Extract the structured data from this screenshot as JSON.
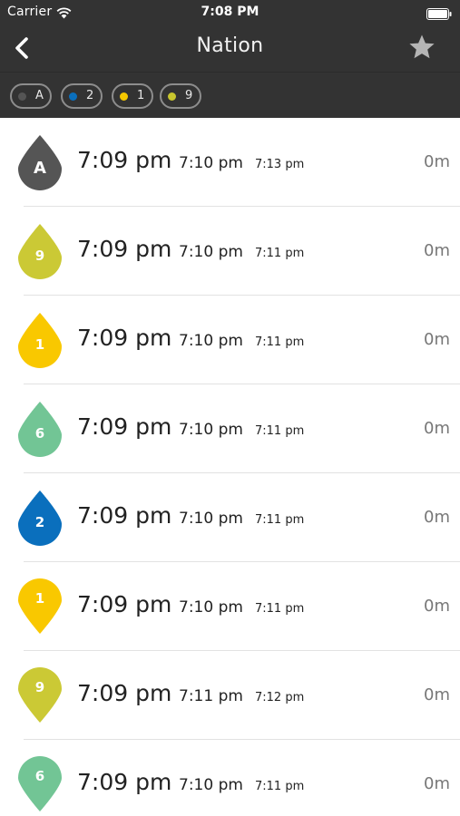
{
  "status_bar": {
    "carrier": "Carrier",
    "time": "7:08 PM"
  },
  "nav": {
    "title": "Nation",
    "back_icon": "chevron-left-icon",
    "star_icon": "star-icon"
  },
  "filters": [
    {
      "label": "A",
      "color": "#555555"
    },
    {
      "label": "2",
      "color": "#0a6fbd"
    },
    {
      "label": "1",
      "color": "#f5c800"
    },
    {
      "label": "9",
      "color": "#c8c62e"
    }
  ],
  "rows": [
    {
      "route": "A",
      "color": "#555555",
      "shape": "up",
      "time1": "7:09 pm",
      "time2": "7:10 pm",
      "time3": "7:13 pm",
      "eta": "0m"
    },
    {
      "route": "9",
      "color": "#cbc935",
      "shape": "up",
      "time1": "7:09 pm",
      "time2": "7:10 pm",
      "time3": "7:11 pm",
      "eta": "0m"
    },
    {
      "route": "1",
      "color": "#f9c800",
      "shape": "up",
      "time1": "7:09 pm",
      "time2": "7:10 pm",
      "time3": "7:11 pm",
      "eta": "0m"
    },
    {
      "route": "6",
      "color": "#72c595",
      "shape": "up",
      "time1": "7:09 pm",
      "time2": "7:10 pm",
      "time3": "7:11 pm",
      "eta": "0m"
    },
    {
      "route": "2",
      "color": "#0a6fbd",
      "shape": "up",
      "time1": "7:09 pm",
      "time2": "7:10 pm",
      "time3": "7:11 pm",
      "eta": "0m"
    },
    {
      "route": "1",
      "color": "#f9c800",
      "shape": "down",
      "time1": "7:09 pm",
      "time2": "7:10 pm",
      "time3": "7:11 pm",
      "eta": "0m"
    },
    {
      "route": "9",
      "color": "#cbc935",
      "shape": "down",
      "time1": "7:09 pm",
      "time2": "7:11 pm",
      "time3": "7:12 pm",
      "eta": "0m"
    },
    {
      "route": "6",
      "color": "#72c595",
      "shape": "down",
      "time1": "7:09 pm",
      "time2": "7:10 pm",
      "time3": "7:11 pm",
      "eta": "0m"
    }
  ]
}
